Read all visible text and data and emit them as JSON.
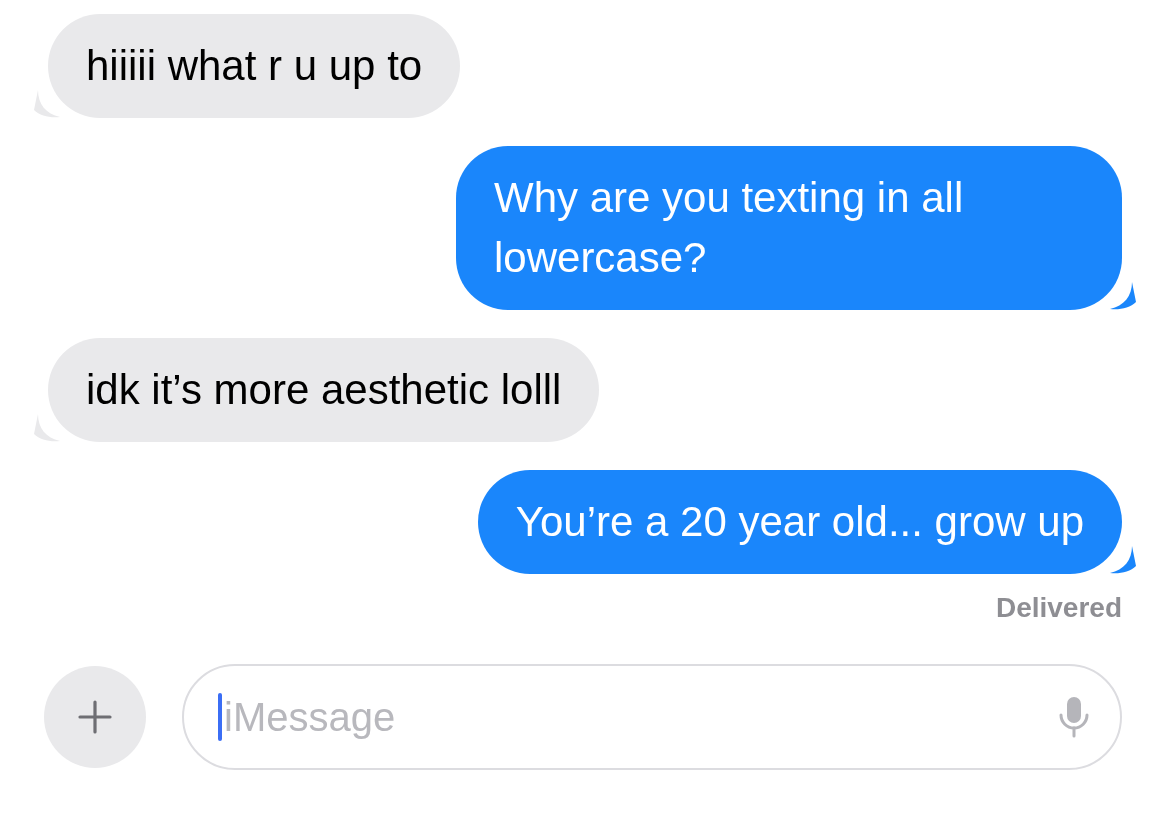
{
  "messages": [
    {
      "kind": "received",
      "text": "hiiiii what r u up to"
    },
    {
      "kind": "sent",
      "text": "Why are you texting in all lowercase?"
    },
    {
      "kind": "received",
      "text": "idk it’s more aesthetic lolll"
    },
    {
      "kind": "sent",
      "text": "You’re a 20 year old... grow up"
    }
  ],
  "status": "Delivered",
  "composer": {
    "placeholder": "iMessage",
    "focused": true
  }
}
